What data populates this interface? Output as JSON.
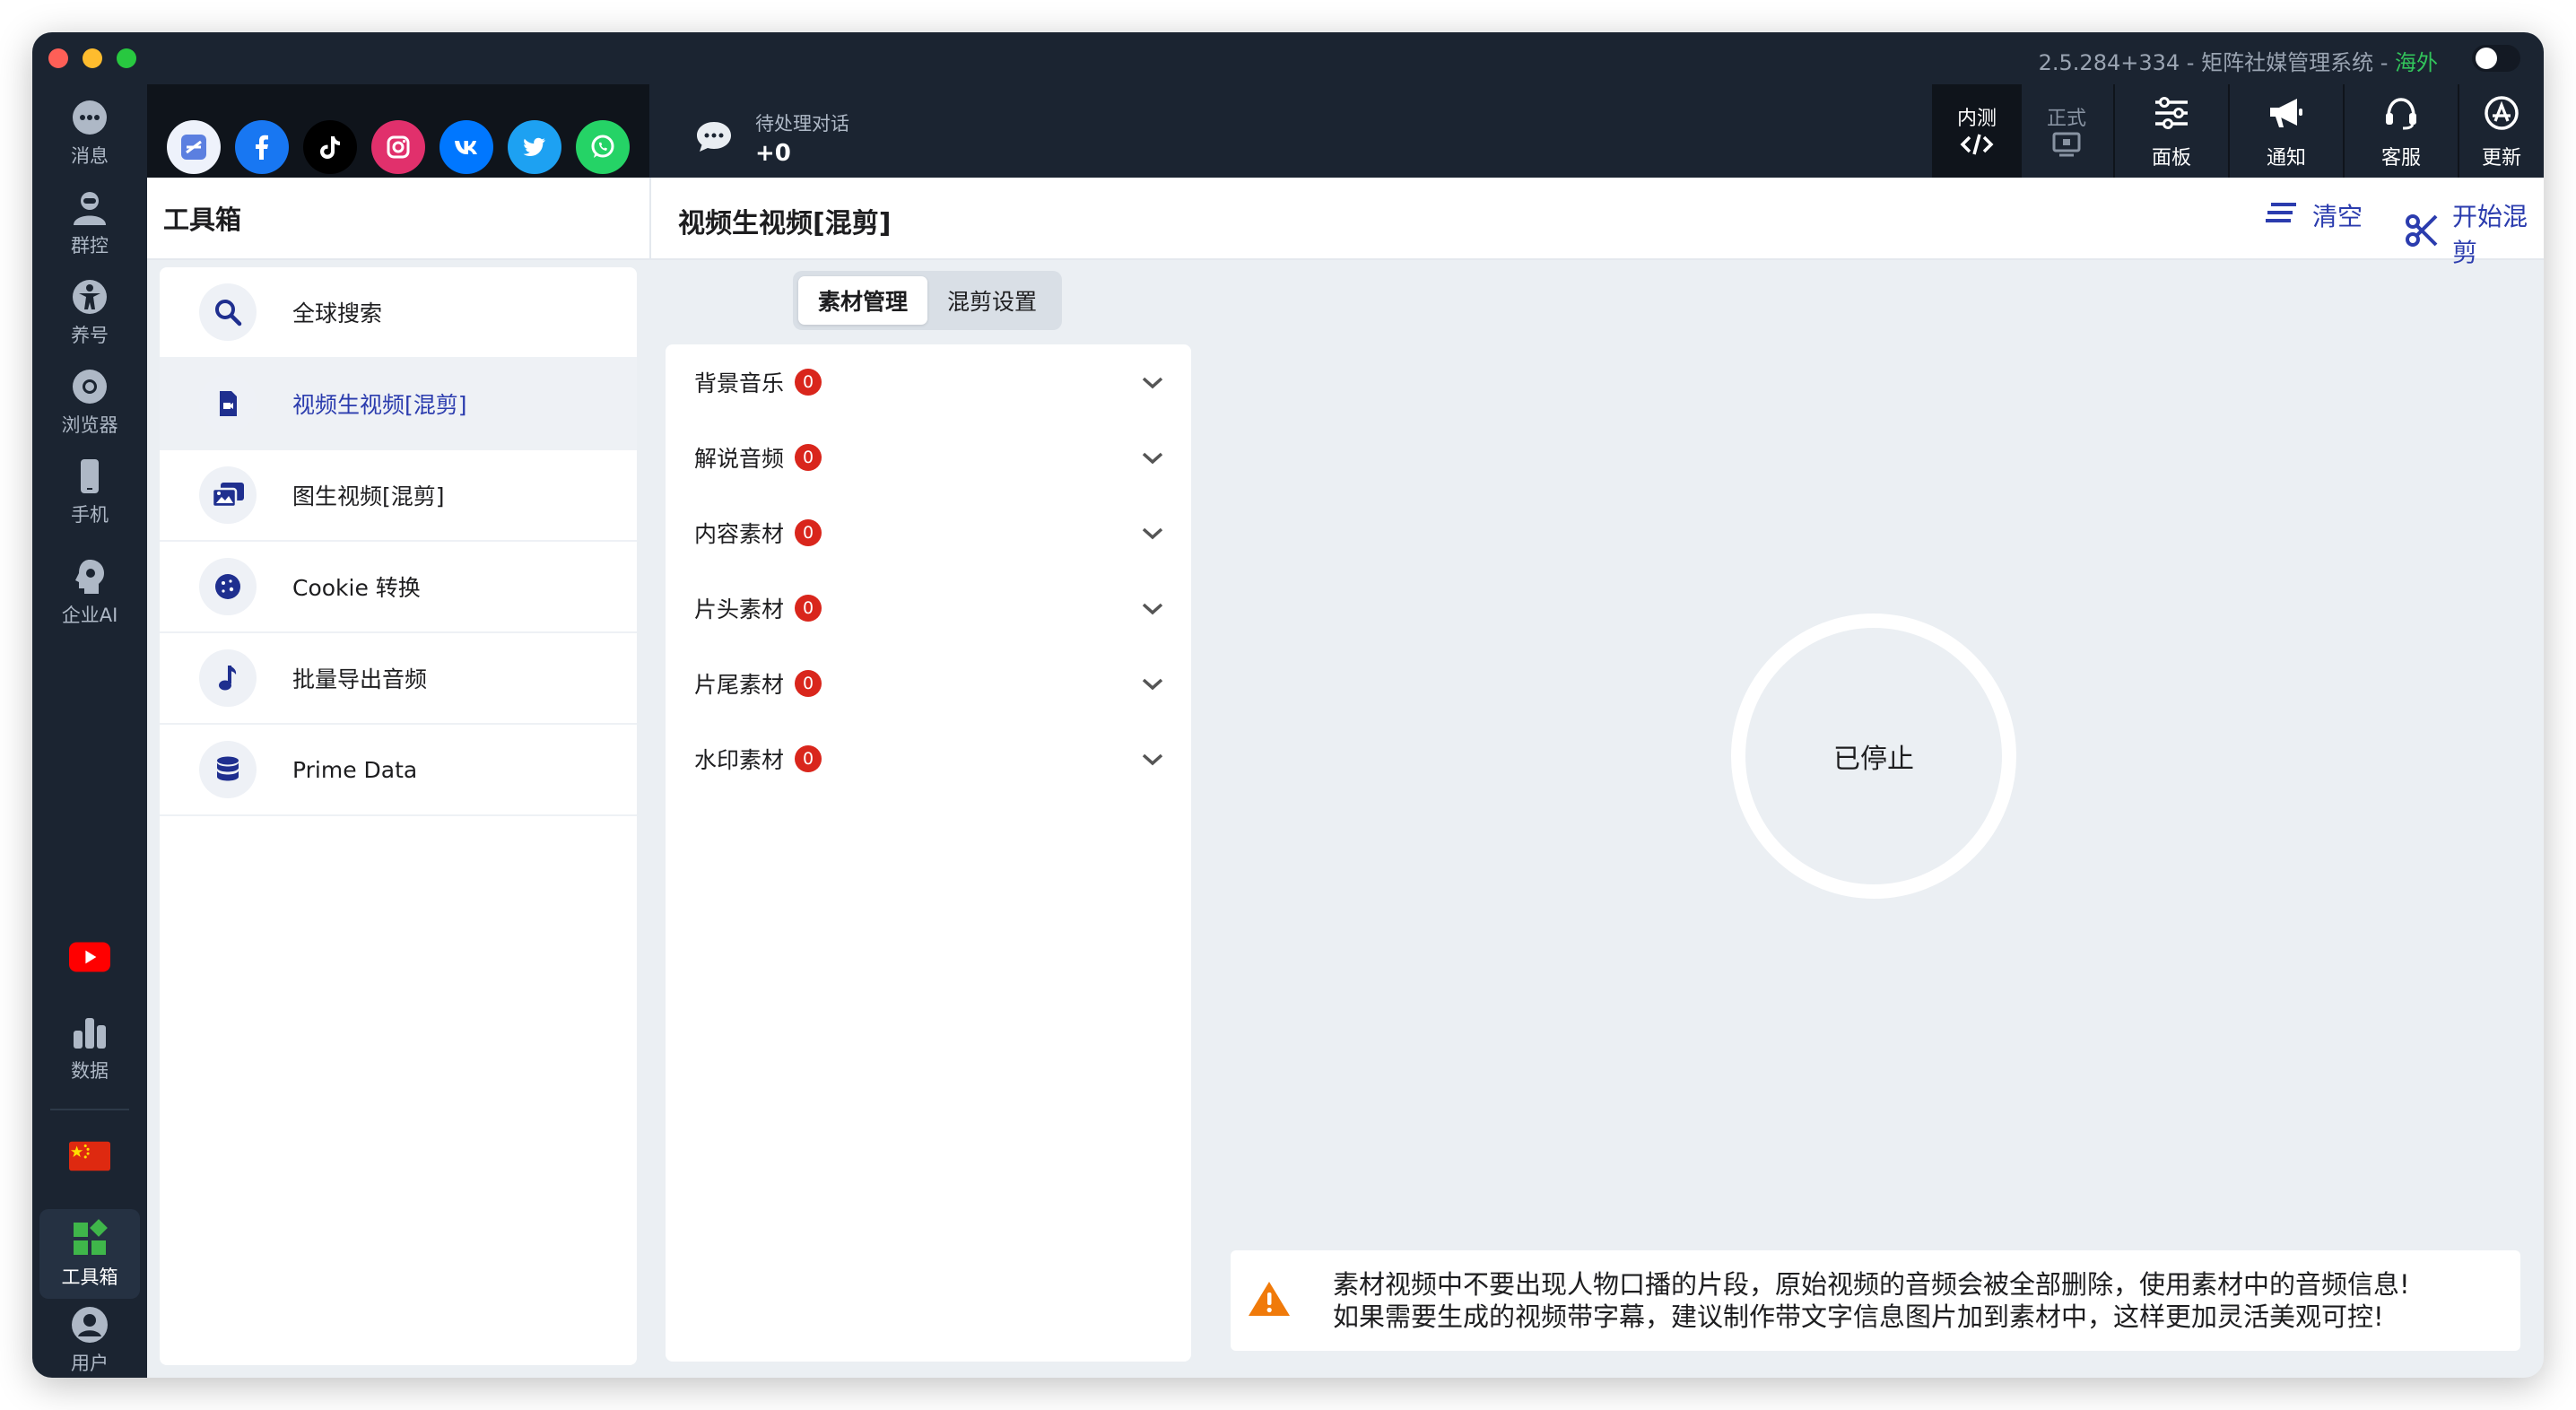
{
  "window": {
    "title": "2.5.284+334 - 矩阵社媒管理系统 -",
    "region": "海外"
  },
  "rail": {
    "items": [
      {
        "label": "消息",
        "icon": "message-icon"
      },
      {
        "label": "群控",
        "icon": "group-control-icon"
      },
      {
        "label": "养号",
        "icon": "account-nurture-icon"
      },
      {
        "label": "浏览器",
        "icon": "browser-icon"
      },
      {
        "label": "手机",
        "icon": "phone-icon"
      },
      {
        "label": "企业AI",
        "icon": "enterprise-ai-icon"
      },
      {
        "label": "",
        "icon": "youtube-icon"
      },
      {
        "label": "数据",
        "icon": "data-icon"
      },
      {
        "label": "",
        "icon": "china-flag-icon"
      },
      {
        "label": "工具箱",
        "icon": "toolbox-icon"
      },
      {
        "label": "用户",
        "icon": "user-icon"
      }
    ]
  },
  "social": [
    "app-store-icon",
    "facebook-icon",
    "tiktok-icon",
    "instagram-icon",
    "vk-icon",
    "twitter-icon",
    "whatsapp-icon"
  ],
  "topbar": {
    "pending_label": "待处理对话",
    "pending_count": "+0",
    "env_test": "内测",
    "env_prod": "正式",
    "panel": "面板",
    "notify": "通知",
    "support": "客服",
    "update": "更新"
  },
  "toolbox": {
    "title": "工具箱",
    "items": [
      {
        "label": "全球搜索",
        "icon": "search-icon"
      },
      {
        "label": "视频生视频[混剪]",
        "icon": "video-file-icon"
      },
      {
        "label": "图生视频[混剪]",
        "icon": "images-icon"
      },
      {
        "label": "Cookie 转换",
        "icon": "cookie-icon"
      },
      {
        "label": "批量导出音频",
        "icon": "music-note-icon"
      },
      {
        "label": "Prime Data",
        "icon": "database-icon"
      }
    ]
  },
  "main": {
    "title": "视频生视频[混剪]",
    "clear_label": "清空",
    "start_label": "开始混剪",
    "tabs": [
      "素材管理",
      "混剪设置"
    ],
    "materials": [
      {
        "label": "背景音乐",
        "count": "0"
      },
      {
        "label": "解说音频",
        "count": "0"
      },
      {
        "label": "内容素材",
        "count": "0"
      },
      {
        "label": "片头素材",
        "count": "0"
      },
      {
        "label": "片尾素材",
        "count": "0"
      },
      {
        "label": "水印素材",
        "count": "0"
      }
    ],
    "status": "已停止",
    "warning_line1": "素材视频中不要出现人物口播的片段，原始视频的音频会被全部删除，使用素材中的音频信息!",
    "warning_line2": "如果需要生成的视频带字幕，建议制作带文字信息图片加到素材中，这样更加灵活美观可控!"
  },
  "colors": {
    "accent": "#2b3cae",
    "dark_bg": "#1b2431",
    "badge": "#d9261c",
    "region_green": "#32c45b",
    "warning": "#f07a0a"
  }
}
